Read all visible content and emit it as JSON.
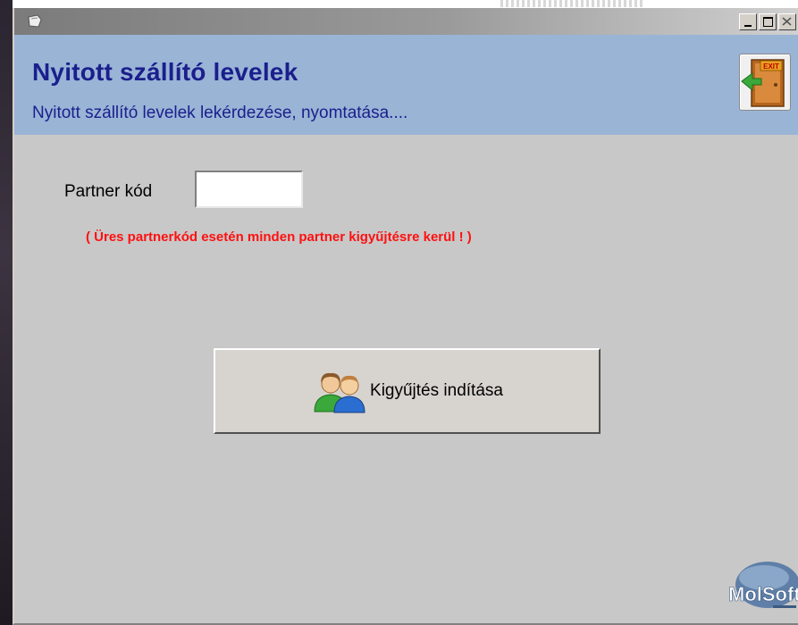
{
  "window": {
    "controls": {
      "minimize": "minimize-icon",
      "maximize": "maximize-icon",
      "close": "close-icon"
    }
  },
  "header": {
    "title": "Nyitott szállító levelek",
    "subtitle": "Nyitott szállító levelek lekérdezése, nyomtatása....",
    "exit_sign": "EXIT",
    "background_color": "#9ab4d6",
    "text_color": "#1a1f8c"
  },
  "form": {
    "partner_label": "Partner kód",
    "partner_value": "",
    "warning": "( Üres partnerkód esetén minden partner kigyűjtésre kerül ! )",
    "warning_color": "#ff1010"
  },
  "actions": {
    "start_label": "Kigyűjtés indítása",
    "start_icon": "users-icon"
  },
  "branding": {
    "logo_text": "MolSoft"
  }
}
